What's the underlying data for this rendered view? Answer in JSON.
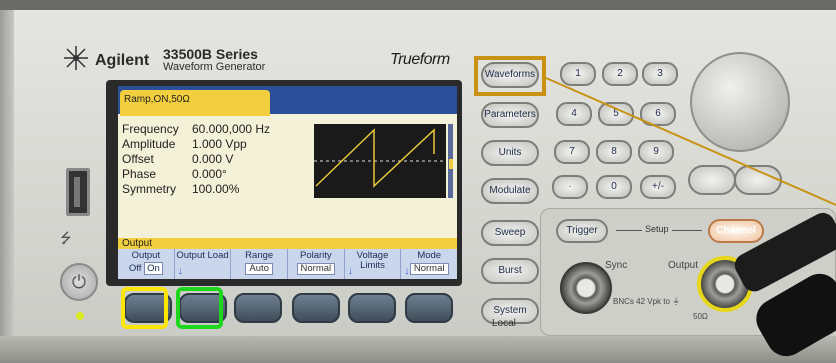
{
  "brand": "Agilent",
  "series": "33500B Series",
  "model": "Waveform Generator",
  "trueform": "Trueform",
  "screen": {
    "channel_tab": "Ramp,ON,50Ω",
    "params": [
      {
        "label": "Frequency",
        "value": "60.000,000 Hz"
      },
      {
        "label": "Amplitude",
        "value": "1.000 Vpp"
      },
      {
        "label": "Offset",
        "value": "0.000 V"
      },
      {
        "label": "Phase",
        "value": "0.000°"
      },
      {
        "label": "Symmetry",
        "value": "100.00%"
      }
    ],
    "output_strip": "Output",
    "softkeys": [
      {
        "label": "Output",
        "value_off": "Off",
        "value_on": "On"
      },
      {
        "label": "Output Load",
        "value": ""
      },
      {
        "label": "Range",
        "value": "Auto"
      },
      {
        "label": "Polarity",
        "value": "Normal"
      },
      {
        "label": "Voltage Limits",
        "value": ""
      },
      {
        "label": "Mode",
        "value": "Normal"
      }
    ]
  },
  "function_keys": [
    "Waveforms",
    "Parameters",
    "Units",
    "Modulate",
    "Sweep",
    "Burst",
    "System"
  ],
  "local_label": "Local",
  "numpad": [
    "1",
    "2",
    "3",
    "4",
    "5",
    "6",
    "7",
    "8",
    "9",
    "·",
    "0",
    "+/-"
  ],
  "setup": {
    "trigger": "Trigger",
    "setup": "Setup",
    "channel": "Channel",
    "sync": "Sync",
    "output": "Output",
    "bnc_note": "BNCs 42 Vpk to ⏚",
    "ohm": "50Ω"
  },
  "icons": [
    "agilent-spark-icon",
    "usb-icon",
    "power-icon"
  ],
  "highlight_colors": {
    "yellow": "#ffe600",
    "green": "#1fd61f",
    "orange": "#c89212"
  }
}
